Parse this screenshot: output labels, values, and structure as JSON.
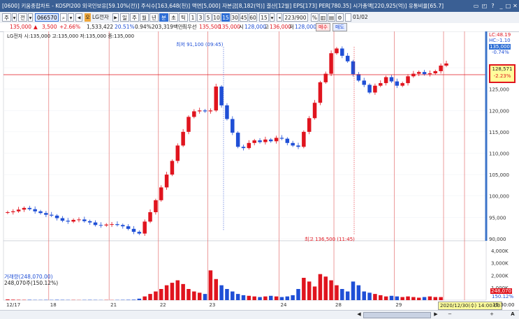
{
  "window": {
    "title": "[0600] 키움종합차트 - KOSPI200 외국인보유[59.10%(전)] 주식수[163,648(천)] 액면[5,000] 자본금[8,182(억)] 결산[12월] EPS[173] PER[780.35] 시가총액[220,925(억)] 유통비율[65.7]"
  },
  "toolbar": {
    "type_label": "주",
    "period_label": "전",
    "code_value": "066570",
    "stock_name": "LG전자",
    "periods": [
      "일",
      "주",
      "월",
      "년",
      "분",
      "초",
      "틱"
    ],
    "minutes": [
      "1",
      "3",
      "5",
      "10",
      "15",
      "30",
      "45",
      "60"
    ],
    "active_minute": "15",
    "interval": "15",
    "count": "223/900",
    "page": "01/02"
  },
  "info": {
    "price": "135,000",
    "change": "3,500",
    "change_pct": "+2.66%",
    "volume": "1,533,422",
    "vol_pct": "20.51%",
    "turnover": "0.94%",
    "amount": "203,319백만",
    "sell_price_label": "최우선",
    "ask": "135,500",
    "bid": "135,000",
    "open_label": "시",
    "open": "128,000",
    "high_label": "고",
    "high": "136,000",
    "low_label": "저",
    "low": "128,000",
    "buy_button": "매수",
    "sell_button": "매도"
  },
  "chart_legend": "LG전자 시:135,000 고:135,000 저:135,000 종:135,000",
  "annotations": {
    "low": "최저 91,100 (09:45)",
    "high": "최고 136,500 (11:45)"
  },
  "right_side": {
    "lc": "LC:48.19",
    "hc": "HC:-1.10",
    "current_price": "135,000",
    "current_pct": "-0.74%",
    "cursor_price": "128,571",
    "cursor_pct": "-2.23%"
  },
  "y_axis": [
    "130,000",
    "125,000",
    "120,000",
    "115,000",
    "110,000",
    "105,000",
    "100,000",
    "95,000",
    "90,000"
  ],
  "volume_panel": {
    "legend": "거래량(248,070.00)",
    "value": "248,070주(150.12%)",
    "y_axis": [
      "4,000K",
      "3,000K",
      "2,000K",
      "1,000K"
    ],
    "current": "248,070",
    "current_pct": "150.12%"
  },
  "x_axis": [
    "12/17",
    "18",
    "21",
    "22",
    "23",
    "24",
    "28",
    "29"
  ],
  "crosshair_time": "2020/12/30(수) 14:00:00",
  "time_end": "15:30:00",
  "colors": {
    "up": "#e0141e",
    "down": "#1f4fd6",
    "title_bg": "#3a5f94"
  },
  "chart_data": {
    "type": "candlestick",
    "interval": "15min",
    "dates": [
      "12/17",
      "18",
      "21",
      "22",
      "23",
      "24",
      "28",
      "29"
    ],
    "close_path": [
      96.2,
      96.4,
      96.8,
      97.2,
      96.9,
      96.4,
      96.0,
      95.6,
      95.4,
      94.8,
      94.2,
      94.0,
      94.4,
      94.5,
      94.1,
      93.8,
      93.2,
      93.1,
      93.3,
      93.4,
      93.2,
      92.9,
      92.3,
      91.6,
      91.2,
      94.0,
      96.2,
      99.0,
      102.0,
      105.0,
      108.2,
      111.8,
      115.0,
      118.5,
      119.8,
      120.0,
      119.8,
      120.0,
      125.6,
      121.2,
      118.0,
      114.8,
      111.5,
      111.2,
      112.4,
      113.0,
      112.6,
      113.2,
      112.8,
      113.6,
      113.4,
      112.4,
      111.8,
      111.5,
      115.0,
      118.2,
      121.8,
      126.6,
      128.6,
      133.4,
      134.5,
      132.8,
      131.5,
      128.5,
      127.0,
      126.0,
      124.2,
      125.8,
      126.4,
      127.8,
      126.8,
      125.8,
      126.4,
      128.0,
      128.6,
      129.0,
      128.5,
      128.7,
      129.2,
      130.5,
      131.0
    ],
    "ylim": [
      89.5,
      138.5
    ],
    "unit": "thousand KRW",
    "volume_k": [
      60,
      40,
      30,
      25,
      30,
      20,
      20,
      25,
      20,
      30,
      25,
      20,
      20,
      15,
      20,
      25,
      20,
      15,
      20,
      15,
      20,
      25,
      30,
      40,
      120,
      300,
      500,
      700,
      900,
      1200,
      1400,
      1600,
      1300,
      900,
      700,
      600,
      500,
      2400,
      1700,
      1200,
      900,
      700,
      500,
      400,
      350,
      300,
      250,
      300,
      350,
      300,
      250,
      300,
      400,
      900,
      1800,
      1500,
      1100,
      2100,
      1900,
      1600,
      1200,
      900,
      700,
      1500,
      1200,
      700,
      600,
      500,
      400,
      300,
      350,
      300,
      250,
      300,
      250,
      200,
      250,
      300,
      250,
      248
    ],
    "volume_ylim": [
      0,
      4500
    ]
  }
}
